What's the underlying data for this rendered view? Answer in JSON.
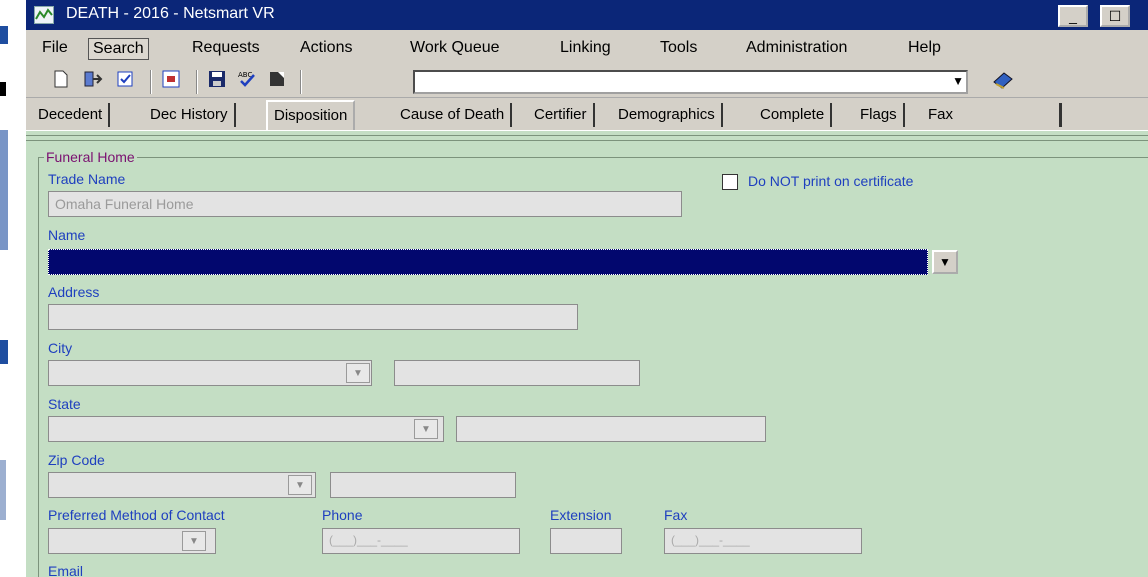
{
  "window": {
    "title": "DEATH - 2016 - Netsmart VR",
    "minimize_glyph": "_",
    "maximize_glyph": "☐"
  },
  "menu": [
    {
      "label": "File"
    },
    {
      "label": "Search"
    },
    {
      "label": "Requests"
    },
    {
      "label": "Actions"
    },
    {
      "label": "Work Queue"
    },
    {
      "label": "Linking"
    },
    {
      "label": "Tools"
    },
    {
      "label": "Administration"
    },
    {
      "label": "Help"
    }
  ],
  "toolbar": {
    "icons": [
      "new-document-icon",
      "exit-icon",
      "checkmark-icon",
      "form-icon",
      "save-icon",
      "spellcheck-icon",
      "dark-square-icon",
      "book-icon"
    ],
    "combo_value": ""
  },
  "tabs": [
    {
      "label": "Decedent"
    },
    {
      "label": "Dec History"
    },
    {
      "label": "Disposition"
    },
    {
      "label": "Cause of Death"
    },
    {
      "label": "Certifier"
    },
    {
      "label": "Demographics"
    },
    {
      "label": "Complete"
    },
    {
      "label": "Flags"
    },
    {
      "label": "Fax"
    }
  ],
  "active_tab": "Disposition",
  "form": {
    "group_title": "Funeral Home",
    "trade_name_label": "Trade Name",
    "trade_name_value": "Omaha Funeral Home",
    "do_not_print_label": "Do NOT print on certificate",
    "name_label": "Name",
    "name_value": "",
    "address_label": "Address",
    "address_value": "",
    "city_label": "City",
    "state_label": "State",
    "zip_label": "Zip Code",
    "contact_label": "Preferred Method of Contact",
    "phone_label": "Phone",
    "phone_value": "(___)___-____",
    "extension_label": "Extension",
    "fax_label": "Fax",
    "fax_value": "(___)___-____",
    "email_label": "Email"
  },
  "colors": {
    "titlebar": "#0b2678",
    "content_bg": "#c4dec4",
    "label_blue": "#1e3fbf",
    "group_title": "#7a1070",
    "selected_field": "#02076e"
  }
}
